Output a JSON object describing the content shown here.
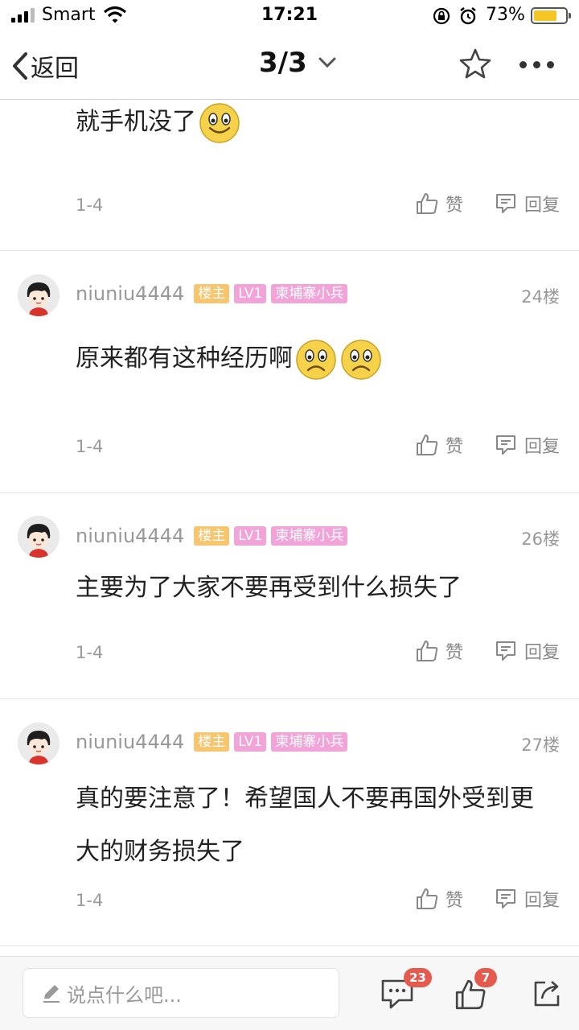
{
  "status_bar": {
    "carrier": "Smart",
    "time": "17:21",
    "battery": "73%",
    "battery_level": 0.73
  },
  "nav": {
    "back_label": "返回",
    "page_indicator": "3/3"
  },
  "posts": [
    {
      "text": "就手机没了",
      "date": "1-4",
      "like_label": "赞",
      "reply_label": "回复"
    },
    {
      "username": "niuniu4444",
      "badges": {
        "owner": "楼主",
        "level": "LV1",
        "title": "柬埔寨小兵"
      },
      "floor": "24楼",
      "text": "原来都有这种经历啊",
      "date": "1-4",
      "like_label": "赞",
      "reply_label": "回复"
    },
    {
      "username": "niuniu4444",
      "badges": {
        "owner": "楼主",
        "level": "LV1",
        "title": "柬埔寨小兵"
      },
      "floor": "26楼",
      "text": "主要为了大家不要再受到什么损失了",
      "date": "1-4",
      "like_label": "赞",
      "reply_label": "回复"
    },
    {
      "username": "niuniu4444",
      "badges": {
        "owner": "楼主",
        "level": "LV1",
        "title": "柬埔寨小兵"
      },
      "floor": "27楼",
      "text": "真的要注意了！希望国人不要再国外受到更大的财务损失了",
      "date": "1-4",
      "like_label": "赞",
      "reply_label": "回复"
    }
  ],
  "bottom_bar": {
    "comment_placeholder": "说点什么吧...",
    "comment_count": "23",
    "like_count": "7"
  },
  "colors": {
    "badge_owner": "#f6c56e",
    "badge_level": "#f2a3d8",
    "count_badge": "#e55a4f",
    "battery": "#f5c626"
  }
}
